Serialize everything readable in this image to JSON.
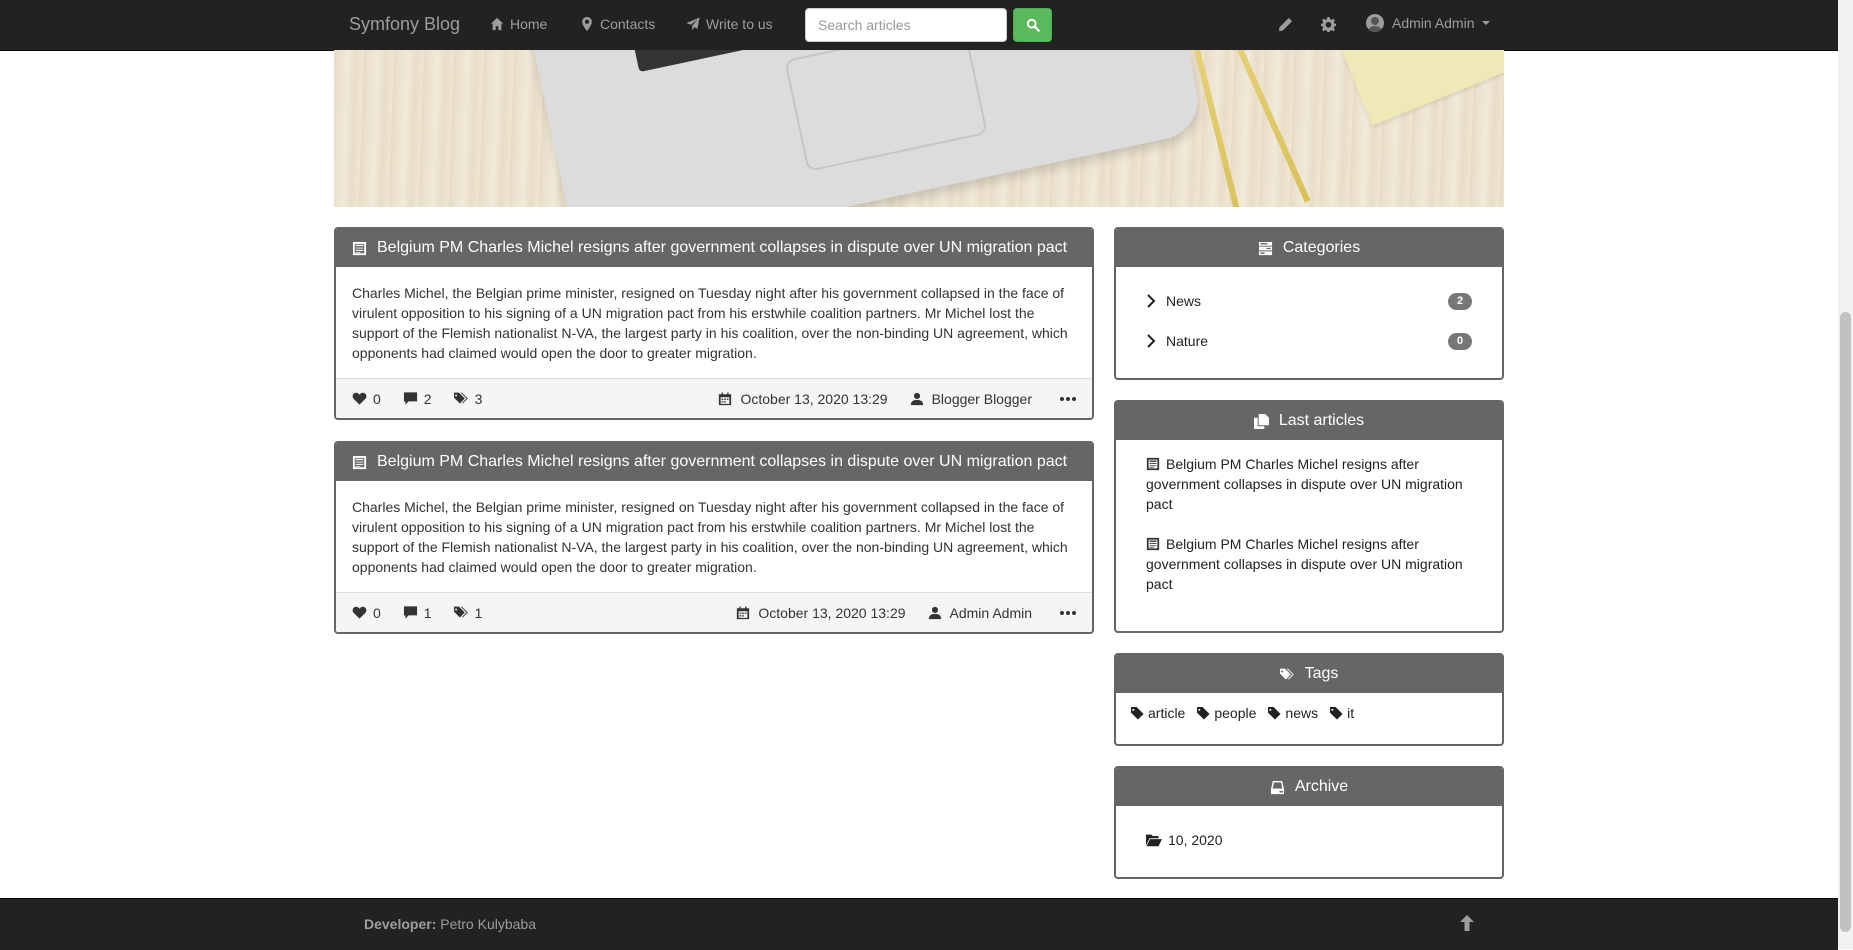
{
  "navbar": {
    "brand": "Symfony Blog",
    "links": [
      {
        "label": "Home",
        "icon": "home-icon"
      },
      {
        "label": "Contacts",
        "icon": "map-marker-icon"
      },
      {
        "label": "Write to us",
        "icon": "paper-plane-icon"
      }
    ],
    "search_placeholder": "Search articles",
    "search_value": "",
    "user_name": "Admin Admin"
  },
  "articles": [
    {
      "title": "Belgium PM Charles Michel resigns after government collapses in dispute over UN migration pact",
      "body": "Charles Michel, the Belgian prime minister, resigned on Tuesday night after his government collapsed in the face of virulent opposition to his signing of a UN migration pact from his erstwhile coalition partners. Mr Michel lost the support of the Flemish nationalist N-VA, the largest party in his coalition, over the non-binding UN agreement, which opponents had claimed would open the door to greater migration.",
      "likes": "0",
      "comments": "2",
      "tags": "3",
      "date": "October 13, 2020 13:29",
      "author": "Blogger Blogger"
    },
    {
      "title": "Belgium PM Charles Michel resigns after government collapses in dispute over UN migration pact",
      "body": "Charles Michel, the Belgian prime minister, resigned on Tuesday night after his government collapsed in the face of virulent opposition to his signing of a UN migration pact from his erstwhile coalition partners. Mr Michel lost the support of the Flemish nationalist N-VA, the largest party in his coalition, over the non-binding UN agreement, which opponents had claimed would open the door to greater migration.",
      "likes": "0",
      "comments": "1",
      "tags": "1",
      "date": "October 13, 2020 13:29",
      "author": "Admin Admin"
    }
  ],
  "sidebar": {
    "categories": {
      "title": "Categories",
      "items": [
        {
          "label": "News",
          "count": "2"
        },
        {
          "label": "Nature",
          "count": "0"
        }
      ]
    },
    "last_articles": {
      "title": "Last articles",
      "items": [
        {
          "label": "Belgium PM Charles Michel resigns after government collapses in dispute over UN migration pact"
        },
        {
          "label": "Belgium PM Charles Michel resigns after government collapses in dispute over UN migration pact"
        }
      ]
    },
    "tags": {
      "title": "Tags",
      "items": [
        "article",
        "people",
        "news",
        "it"
      ]
    },
    "archive": {
      "title": "Archive",
      "items": [
        "10, 2020"
      ]
    }
  },
  "footer": {
    "developer_label": "Developer:",
    "developer_name": "Petro Kulybaba"
  },
  "colors": {
    "navbar_bg": "#222222",
    "panel_header": "#666666",
    "search_button": "#5cb85c"
  }
}
